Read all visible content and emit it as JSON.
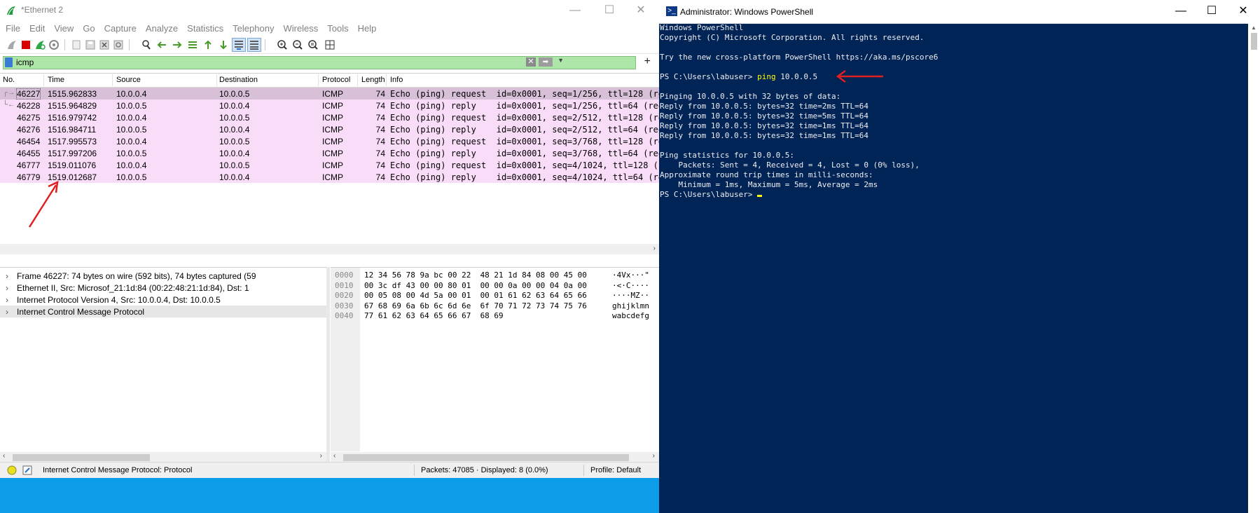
{
  "wireshark": {
    "title": "*Ethernet 2",
    "menu": [
      "File",
      "Edit",
      "View",
      "Go",
      "Capture",
      "Analyze",
      "Statistics",
      "Telephony",
      "Wireless",
      "Tools",
      "Help"
    ],
    "filter": {
      "value": "icmp"
    },
    "columns": [
      "No.",
      "Time",
      "Source",
      "Destination",
      "Protocol",
      "Length",
      "Info"
    ],
    "packets": [
      {
        "no": "46227",
        "time": "1515.962833",
        "src": "10.0.0.4",
        "dst": "10.0.0.5",
        "proto": "ICMP",
        "len": "74",
        "info": "Echo (ping) request  id=0x0001, seq=1/256, ttl=128 (re"
      },
      {
        "no": "46228",
        "time": "1515.964829",
        "src": "10.0.0.5",
        "dst": "10.0.0.4",
        "proto": "ICMP",
        "len": "74",
        "info": "Echo (ping) reply    id=0x0001, seq=1/256, ttl=64 (req"
      },
      {
        "no": "46275",
        "time": "1516.979742",
        "src": "10.0.0.4",
        "dst": "10.0.0.5",
        "proto": "ICMP",
        "len": "74",
        "info": "Echo (ping) request  id=0x0001, seq=2/512, ttl=128 (re"
      },
      {
        "no": "46276",
        "time": "1516.984711",
        "src": "10.0.0.5",
        "dst": "10.0.0.4",
        "proto": "ICMP",
        "len": "74",
        "info": "Echo (ping) reply    id=0x0001, seq=2/512, ttl=64 (req"
      },
      {
        "no": "46454",
        "time": "1517.995573",
        "src": "10.0.0.4",
        "dst": "10.0.0.5",
        "proto": "ICMP",
        "len": "74",
        "info": "Echo (ping) request  id=0x0001, seq=3/768, ttl=128 (re"
      },
      {
        "no": "46455",
        "time": "1517.997206",
        "src": "10.0.0.5",
        "dst": "10.0.0.4",
        "proto": "ICMP",
        "len": "74",
        "info": "Echo (ping) reply    id=0x0001, seq=3/768, ttl=64 (req"
      },
      {
        "no": "46777",
        "time": "1519.011076",
        "src": "10.0.0.4",
        "dst": "10.0.0.5",
        "proto": "ICMP",
        "len": "74",
        "info": "Echo (ping) request  id=0x0001, seq=4/1024, ttl=128 (r"
      },
      {
        "no": "46779",
        "time": "1519.012687",
        "src": "10.0.0.5",
        "dst": "10.0.0.4",
        "proto": "ICMP",
        "len": "74",
        "info": "Echo (ping) reply    id=0x0001, seq=4/1024, ttl=64 (re"
      }
    ],
    "details": [
      "Frame 46227: 74 bytes on wire (592 bits), 74 bytes captured (59",
      "Ethernet II, Src: Microsof_21:1d:84 (00:22:48:21:1d:84), Dst: 1",
      "Internet Protocol Version 4, Src: 10.0.0.4, Dst: 10.0.0.5",
      "Internet Control Message Protocol"
    ],
    "bytes": [
      {
        "off": "0000",
        "hex": "12 34 56 78 9a bc 00 22  48 21 1d 84 08 00 45 00",
        "ascii": "·4Vx···\""
      },
      {
        "off": "0010",
        "hex": "00 3c df 43 00 00 80 01  00 00 0a 00 00 04 0a 00",
        "ascii": "·<·C····"
      },
      {
        "off": "0020",
        "hex": "00 05 08 00 4d 5a 00 01  00 01 61 62 63 64 65 66",
        "ascii": "····MZ··"
      },
      {
        "off": "0030",
        "hex": "67 68 69 6a 6b 6c 6d 6e  6f 70 71 72 73 74 75 76",
        "ascii": "ghijklmn"
      },
      {
        "off": "0040",
        "hex": "77 61 62 63 64 65 66 67  68 69",
        "ascii": "wabcdefg"
      }
    ],
    "status": {
      "field": "Internet Control Message Protocol: Protocol",
      "packets": "Packets: 47085 · Displayed: 8 (0.0%)",
      "profile": "Profile: Default"
    }
  },
  "powershell": {
    "title": "Administrator: Windows PowerShell",
    "lines": {
      "l1": "Windows PowerShell",
      "l2": "Copyright (C) Microsoft Corporation. All rights reserved.",
      "l3": "Try the new cross-platform PowerShell https://aka.ms/pscore6",
      "prompt": "PS C:\\Users\\labuser> ",
      "cmd": "ping",
      "arg": " 10.0.0.5",
      "l5": "Pinging 10.0.0.5 with 32 bytes of data:",
      "l6": "Reply from 10.0.0.5: bytes=32 time=2ms TTL=64",
      "l7": "Reply from 10.0.0.5: bytes=32 time=5ms TTL=64",
      "l8": "Reply from 10.0.0.5: bytes=32 time=1ms TTL=64",
      "l9": "Reply from 10.0.0.5: bytes=32 time=1ms TTL=64",
      "l10": "Ping statistics for 10.0.0.5:",
      "l11": "    Packets: Sent = 4, Received = 4, Lost = 0 (0% loss),",
      "l12": "Approximate round trip times in milli-seconds:",
      "l13": "    Minimum = 1ms, Maximum = 5ms, Average = 2ms",
      "l14": "PS C:\\Users\\labuser> "
    }
  },
  "colors": {
    "packet_row": "#f9dcf7",
    "selected_row": "#d7c0d8",
    "filter_ok": "#ade6a8",
    "ps_bg": "#012456",
    "annotation": "#e02020"
  }
}
